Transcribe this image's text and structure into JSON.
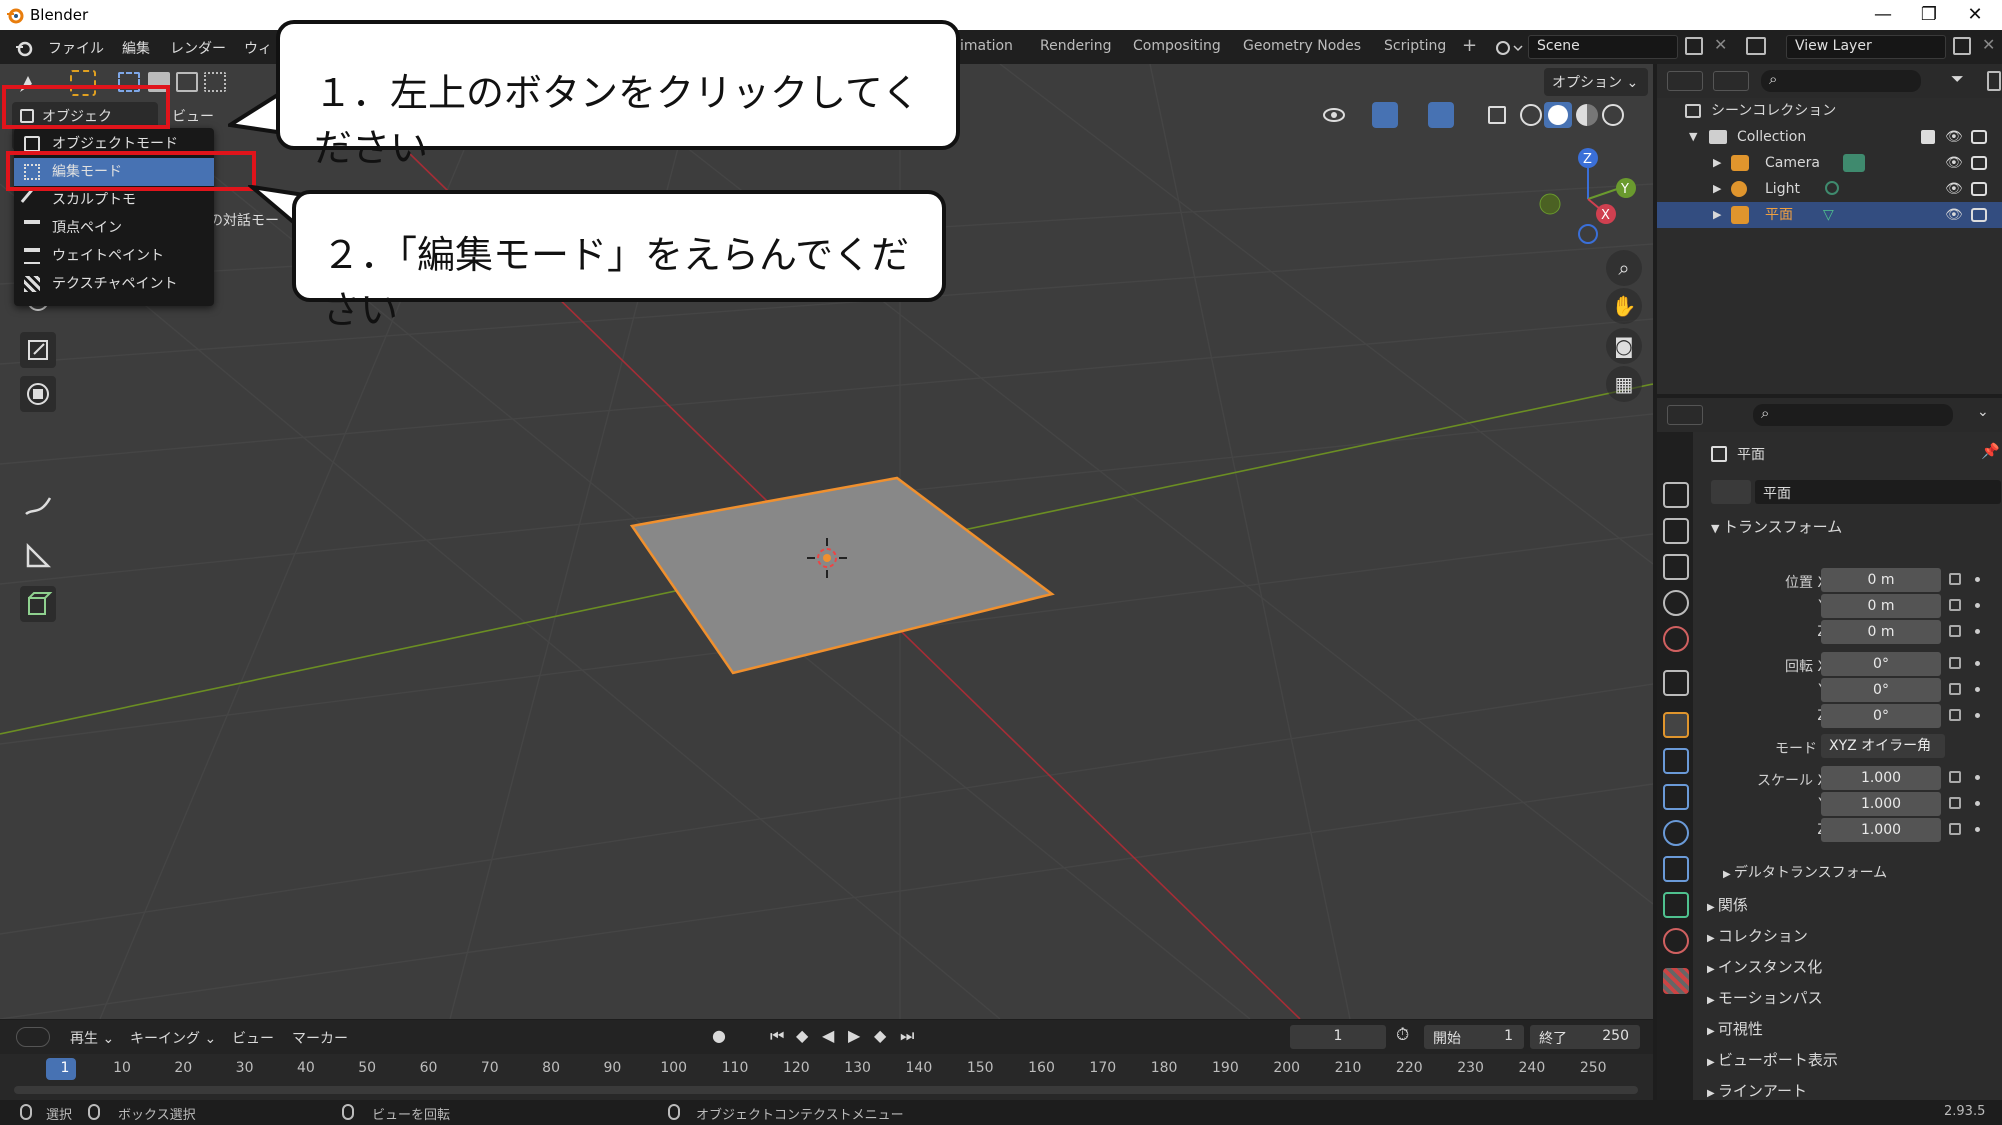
{
  "window": {
    "title": "Blender",
    "minimize": "—",
    "maximize": "❐",
    "close": "✕"
  },
  "menubar": {
    "items": [
      "ファイル",
      "編集",
      "レンダー",
      "ウィ"
    ],
    "workspace_tabs": [
      "imation",
      "Rendering",
      "Compositing",
      "Geometry Nodes",
      "Scripting",
      "+"
    ],
    "scene": "Scene",
    "view_layer": "View Layer"
  },
  "viewport": {
    "mode_button": "オブジェクト...",
    "view_menu": "ビュー",
    "options": "オプション",
    "tooltip": "オブジェクトの対話モー",
    "mode_menu": [
      {
        "label": "オブジェクトモード",
        "icon": "object-mode-icon"
      },
      {
        "label": "編集モード",
        "icon": "edit-mode-icon"
      },
      {
        "label": "スカルプトモ",
        "icon": "sculpt-mode-icon"
      },
      {
        "label": "頂点ペイン",
        "icon": "vertex-paint-icon"
      },
      {
        "label": "ウェイトペイント",
        "icon": "weight-paint-icon"
      },
      {
        "label": "テクスチャペイント",
        "icon": "texture-paint-icon"
      }
    ],
    "gizmo": {
      "x": "X",
      "y": "Y",
      "z": "Z"
    }
  },
  "callouts": {
    "step1": "１．左上のボタンをクリックしてください",
    "step2": "２．「編集モード」をえらんでください"
  },
  "outliner": {
    "scene_collection": "シーンコレクション",
    "collection": "Collection",
    "objects": [
      "Camera",
      "Light",
      "平面"
    ]
  },
  "properties": {
    "object_name": "平面",
    "data_name": "平面",
    "transform": "トランスフォーム",
    "location_label": "位置 X",
    "y": "Y",
    "z": "Z",
    "rotation_label": "回転 X",
    "mode_label": "モード",
    "mode_value": "XYZ オイラー角",
    "scale_label": "スケール X",
    "location": [
      "0 m",
      "0 m",
      "0 m"
    ],
    "rotation": [
      "0°",
      "0°",
      "0°"
    ],
    "scale": [
      "1.000",
      "1.000",
      "1.000"
    ],
    "delta": "デルタトランスフォーム",
    "sections": [
      "関係",
      "コレクション",
      "インスタンス化",
      "モーションパス",
      "可視性",
      "ビューポート表示",
      "ラインアート"
    ]
  },
  "timeline": {
    "play": "再生",
    "keying": "キーイング",
    "view": "ビュー",
    "marker": "マーカー",
    "current_frame": "1",
    "start_label": "開始",
    "start": "1",
    "end_label": "終了",
    "end": "250",
    "frames": [
      "1",
      "10",
      "20",
      "30",
      "40",
      "50",
      "60",
      "70",
      "80",
      "90",
      "100",
      "110",
      "120",
      "130",
      "140",
      "150",
      "160",
      "170",
      "180",
      "190",
      "200",
      "210",
      "220",
      "230",
      "240",
      "250"
    ]
  },
  "statusbar": {
    "select": "選択",
    "box_select": "ボックス選択",
    "rotate_view": "ビューを回転",
    "context_menu": "オブジェクトコンテクストメニュー",
    "version": "2.93.5"
  },
  "colors": {
    "accent": "#4772b3",
    "selection": "#f0902e",
    "callout_border": "#e0141b"
  }
}
